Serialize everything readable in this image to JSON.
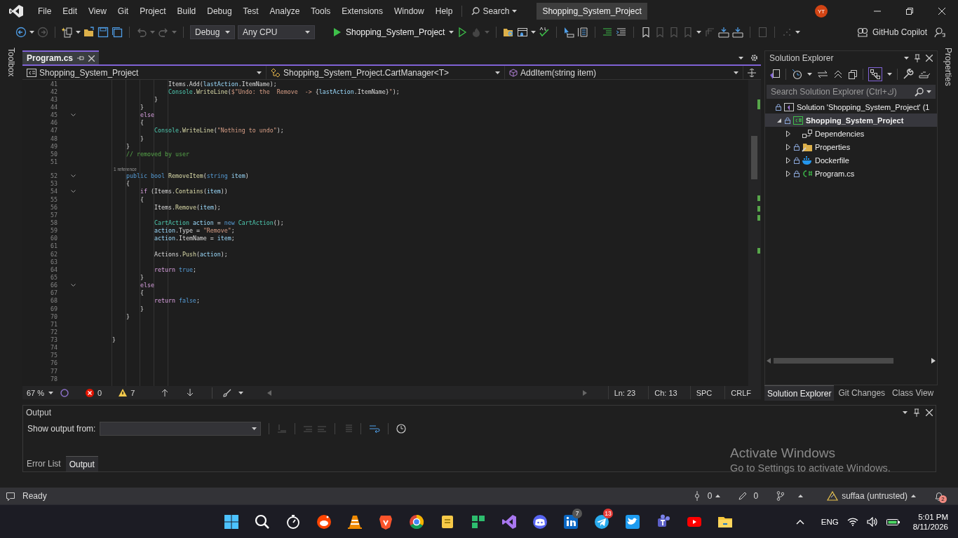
{
  "menu": [
    "File",
    "Edit",
    "View",
    "Git",
    "Project",
    "Build",
    "Debug",
    "Test",
    "Analyze",
    "Tools",
    "Extensions",
    "Window",
    "Help"
  ],
  "search": "Search",
  "title": "Shopping_System_Project",
  "avatar": "YT",
  "toolbar": {
    "configuration": "Debug",
    "platform": "Any CPU",
    "run_target": "Shopping_System_Project",
    "copilot": "GitHub Copilot"
  },
  "toolbox": "Toolbox",
  "properties": "Properties",
  "doc_tabs": [
    {
      "label": "Program.cs",
      "selected": true
    }
  ],
  "nav": [
    "Shopping_System_Project",
    "Shopping_System_Project.CartManager<T>",
    "AddItem(string item)"
  ],
  "code": [
    {
      "n": "41",
      "fold": false,
      "segs": [
        {
          "kind": "plain",
          "text": "                    Items.Add("
        },
        {
          "kind": "variable",
          "text": "lastAction"
        },
        {
          "kind": "plain",
          "text": ".ItemName);"
        }
      ]
    },
    {
      "n": "42",
      "fold": false,
      "segs": [
        {
          "kind": "type",
          "text": "                    Console"
        },
        {
          "kind": "plain",
          "text": "."
        },
        {
          "kind": "method",
          "text": "WriteLine"
        },
        {
          "kind": "plain",
          "text": "("
        },
        {
          "kind": "string",
          "text": "$\"Undo: the  Remove  -> "
        },
        {
          "kind": "plain",
          "text": "{"
        },
        {
          "kind": "variable",
          "text": "lastAction"
        },
        {
          "kind": "plain",
          "text": ".ItemName}"
        },
        {
          "kind": "string",
          "text": "\""
        },
        {
          "kind": "plain",
          "text": ");"
        }
      ]
    },
    {
      "n": "43",
      "fold": false,
      "segs": [
        {
          "kind": "plain",
          "text": "                }"
        }
      ]
    },
    {
      "n": "44",
      "fold": false,
      "segs": [
        {
          "kind": "plain",
          "text": "            }"
        }
      ]
    },
    {
      "n": "45",
      "fold": true,
      "segs": [
        {
          "kind": "control",
          "text": "            else"
        }
      ]
    },
    {
      "n": "46",
      "fold": false,
      "segs": [
        {
          "kind": "plain",
          "text": "            {"
        }
      ]
    },
    {
      "n": "47",
      "fold": false,
      "segs": [
        {
          "kind": "type",
          "text": "                Console"
        },
        {
          "kind": "plain",
          "text": "."
        },
        {
          "kind": "method",
          "text": "WriteLine"
        },
        {
          "kind": "plain",
          "text": "("
        },
        {
          "kind": "string",
          "text": "\"Nothing to undo\""
        },
        {
          "kind": "plain",
          "text": ");"
        }
      ]
    },
    {
      "n": "48",
      "fold": false,
      "segs": [
        {
          "kind": "plain",
          "text": "            }"
        }
      ]
    },
    {
      "n": "49",
      "fold": false,
      "segs": [
        {
          "kind": "plain",
          "text": "        }"
        }
      ]
    },
    {
      "n": "50",
      "fold": false,
      "segs": [
        {
          "kind": "comment",
          "text": "        // removed by user"
        }
      ]
    },
    {
      "n": "51",
      "fold": false
    },
    {
      "n": "52",
      "fold": true,
      "lens": "1 reference",
      "segs": [
        {
          "kind": "keyword",
          "text": "        public bool "
        },
        {
          "kind": "method",
          "text": "RemoveItem"
        },
        {
          "kind": "plain",
          "text": "("
        },
        {
          "kind": "keyword",
          "text": "string "
        },
        {
          "kind": "variable",
          "text": "item"
        },
        {
          "kind": "plain",
          "text": ")"
        }
      ]
    },
    {
      "n": "53",
      "fold": false,
      "segs": [
        {
          "kind": "plain",
          "text": "        {"
        }
      ]
    },
    {
      "n": "54",
      "fold": true,
      "segs": [
        {
          "kind": "control",
          "text": "            if"
        },
        {
          "kind": "plain",
          "text": " (Items."
        },
        {
          "kind": "method",
          "text": "Contains"
        },
        {
          "kind": "plain",
          "text": "("
        },
        {
          "kind": "variable",
          "text": "item"
        },
        {
          "kind": "plain",
          "text": "))"
        }
      ]
    },
    {
      "n": "55",
      "fold": false,
      "segs": [
        {
          "kind": "plain",
          "text": "            {"
        }
      ]
    },
    {
      "n": "56",
      "fold": false,
      "segs": [
        {
          "kind": "plain",
          "text": "                Items."
        },
        {
          "kind": "method",
          "text": "Remove"
        },
        {
          "kind": "plain",
          "text": "("
        },
        {
          "kind": "variable",
          "text": "item"
        },
        {
          "kind": "plain",
          "text": ");"
        }
      ]
    },
    {
      "n": "57",
      "fold": false
    },
    {
      "n": "58",
      "fold": false,
      "segs": [
        {
          "kind": "type",
          "text": "                CartAction "
        },
        {
          "kind": "variable",
          "text": "action"
        },
        {
          "kind": "plain",
          "text": " = "
        },
        {
          "kind": "keyword",
          "text": "new "
        },
        {
          "kind": "type",
          "text": "CartAction"
        },
        {
          "kind": "plain",
          "text": "();"
        }
      ]
    },
    {
      "n": "59",
      "fold": false,
      "segs": [
        {
          "kind": "variable",
          "text": "                action"
        },
        {
          "kind": "plain",
          "text": ".Type = "
        },
        {
          "kind": "string",
          "text": "\"Remove\""
        },
        {
          "kind": "plain",
          "text": ";"
        }
      ]
    },
    {
      "n": "60",
      "fold": false,
      "segs": [
        {
          "kind": "variable",
          "text": "                action"
        },
        {
          "kind": "plain",
          "text": ".ItemName = "
        },
        {
          "kind": "variable",
          "text": "item"
        },
        {
          "kind": "plain",
          "text": ";"
        }
      ]
    },
    {
      "n": "61",
      "fold": false
    },
    {
      "n": "62",
      "fold": false,
      "segs": [
        {
          "kind": "plain",
          "text": "                Actions."
        },
        {
          "kind": "method",
          "text": "Push"
        },
        {
          "kind": "plain",
          "text": "("
        },
        {
          "kind": "variable",
          "text": "action"
        },
        {
          "kind": "plain",
          "text": ");"
        }
      ]
    },
    {
      "n": "63",
      "fold": false
    },
    {
      "n": "64",
      "fold": false,
      "segs": [
        {
          "kind": "control",
          "text": "                return "
        },
        {
          "kind": "keyword",
          "text": "true"
        },
        {
          "kind": "plain",
          "text": ";"
        }
      ]
    },
    {
      "n": "65",
      "fold": false,
      "segs": [
        {
          "kind": "plain",
          "text": "            }"
        }
      ]
    },
    {
      "n": "66",
      "fold": true,
      "segs": [
        {
          "kind": "control",
          "text": "            else"
        }
      ]
    },
    {
      "n": "67",
      "fold": false,
      "segs": [
        {
          "kind": "plain",
          "text": "            {"
        }
      ]
    },
    {
      "n": "68",
      "fold": false,
      "segs": [
        {
          "kind": "control",
          "text": "                return "
        },
        {
          "kind": "keyword",
          "text": "false"
        },
        {
          "kind": "plain",
          "text": ";"
        }
      ]
    },
    {
      "n": "69",
      "fold": false,
      "segs": [
        {
          "kind": "plain",
          "text": "            }"
        }
      ]
    },
    {
      "n": "70",
      "fold": false,
      "segs": [
        {
          "kind": "plain",
          "text": "        }"
        }
      ]
    },
    {
      "n": "71",
      "fold": false
    },
    {
      "n": "72",
      "fold": false
    },
    {
      "n": "73",
      "fold": false,
      "segs": [
        {
          "kind": "plain",
          "text": "    }"
        }
      ]
    },
    {
      "n": "74",
      "fold": false
    },
    {
      "n": "75",
      "fold": false
    },
    {
      "n": "76",
      "fold": false
    },
    {
      "n": "77",
      "fold": false
    },
    {
      "n": "78",
      "fold": false
    }
  ],
  "editor_status": {
    "zoom": "67 %",
    "errors": "0",
    "warnings": "7",
    "line": "Ln: 23",
    "column": "Ch: 13",
    "whitespace": "SPC",
    "line_ending": "CRLF"
  },
  "solution_explorer": {
    "title": "Solution Explorer",
    "placeholder": "Search Solution Explorer (Ctrl+ك)",
    "tree": [
      {
        "label": "Solution 'Shopping_System_Project' (1",
        "kind": "solution",
        "locked": true,
        "selected": false,
        "children": [
          {
            "label": "Shopping_System_Project",
            "kind": "project",
            "locked": true,
            "selected": true,
            "expanded": true,
            "children": [
              {
                "label": "Dependencies",
                "kind": "dependencies",
                "locked": false,
                "selected": false,
                "expanded": false
              },
              {
                "label": "Properties",
                "kind": "properties",
                "locked": true,
                "selected": false,
                "expanded": false
              },
              {
                "label": "Dockerfile",
                "kind": "docker",
                "locked": true,
                "selected": false,
                "expanded": false
              },
              {
                "label": "Program.cs",
                "kind": "csharp",
                "locked": true,
                "selected": false,
                "expanded": false
              }
            ]
          }
        ]
      }
    ]
  },
  "panel_tabs": [
    {
      "label": "Solution Explorer",
      "selected": true
    },
    {
      "label": "Git Changes",
      "selected": false
    },
    {
      "label": "Class View",
      "selected": false
    }
  ],
  "output": {
    "title": "Output",
    "source_label": "Show output from:"
  },
  "bottom_tabs": [
    {
      "label": "Error List",
      "selected": false
    },
    {
      "label": "Output",
      "selected": true
    }
  ],
  "activation": {
    "title": "Activate Windows",
    "subtitle": "Go to Settings to activate Windows."
  },
  "status_bar": {
    "ready": "Ready",
    "pending": "0",
    "edits": "0",
    "repository": "suffaa (untrusted)",
    "notifications": "2"
  },
  "taskbar": {
    "apps": [
      {
        "kind": "start"
      },
      {
        "kind": "search"
      },
      {
        "kind": "stopwatch"
      },
      {
        "kind": "reddit"
      },
      {
        "kind": "cone"
      },
      {
        "kind": "shield"
      },
      {
        "kind": "chrome"
      },
      {
        "kind": "notes"
      },
      {
        "kind": "tiles"
      },
      {
        "kind": "vs"
      },
      {
        "kind": "discord"
      },
      {
        "kind": "linkedin",
        "badge": "7"
      },
      {
        "kind": "telegram",
        "badge": "13"
      },
      {
        "kind": "twitter"
      },
      {
        "kind": "teams"
      },
      {
        "kind": "youtube"
      },
      {
        "kind": "explorer"
      }
    ],
    "language": "ENG",
    "time": "5:01 PM",
    "date": "8/11/2026"
  }
}
